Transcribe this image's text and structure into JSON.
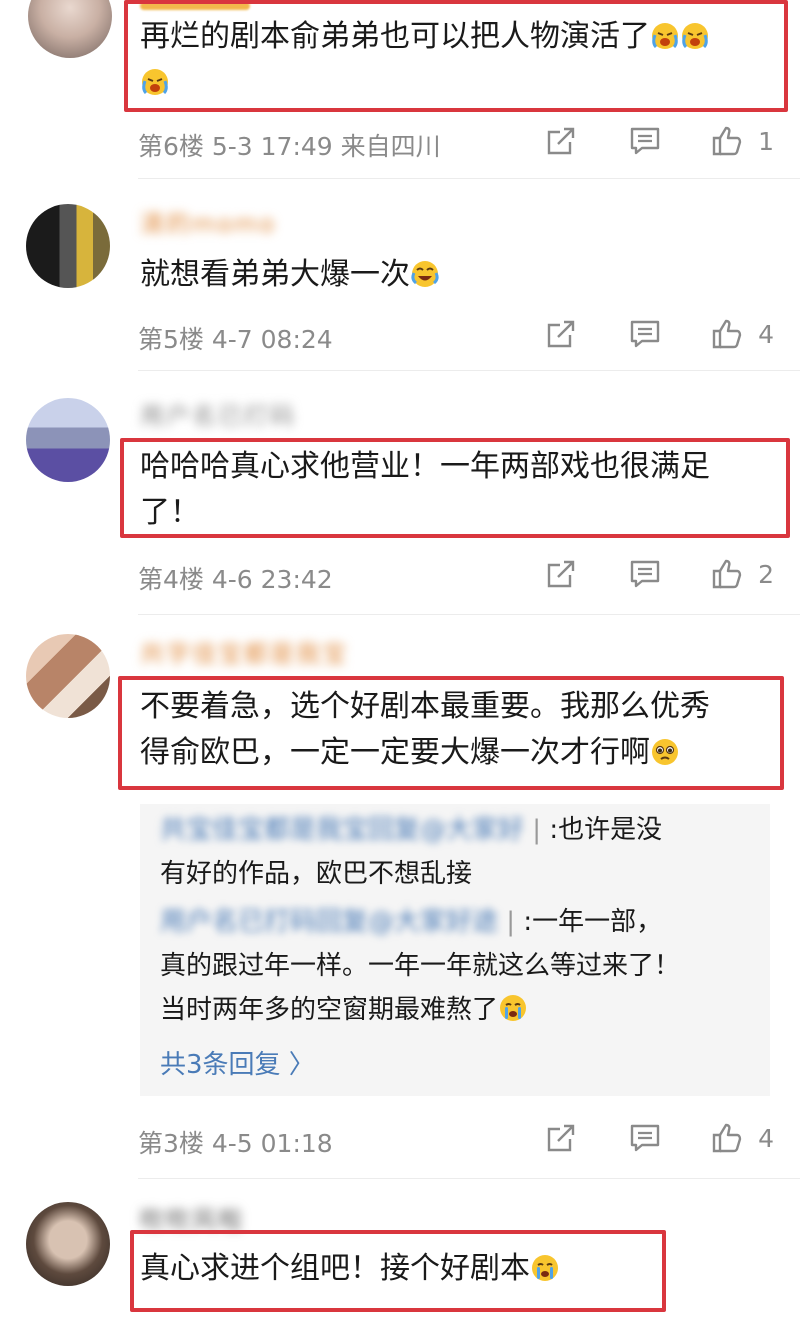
{
  "comments": [
    {
      "text_line1": "再烂的剧本俞弟弟也可以把人物演活了",
      "floor": "第6楼",
      "date": "5-3 17:49",
      "location": "来自四川",
      "likes": "1"
    },
    {
      "username": "清的momo",
      "text_line1": "就想看弟弟大爆一次",
      "floor": "第5楼",
      "date": "4-7 08:24",
      "likes": "4"
    },
    {
      "username": "用户名已打码",
      "text_line1": "哈哈哈真心求他营业！一年两部戏也很满足",
      "text_line2": "了！",
      "floor": "第4楼",
      "date": "4-6 23:42",
      "likes": "2"
    },
    {
      "username": "共字佳宝都是我宝",
      "text_line1": "不要着急，选个好剧本最重要。我那么优秀",
      "text_line2": "得俞欧巴，一定一定要大爆一次才行啊",
      "replies": [
        {
          "name": "共宝佳宝都是我宝回复@大家好",
          "line1": ":也许是没",
          "line2": "有好的作品，欧巴不想乱接"
        },
        {
          "name": "用户名已打码回复@大家好途",
          "line1": ":一年一部，",
          "line2": "真的跟过年一样。一年一年就这么等过来了！",
          "line3": "当时两年多的空窗期最难熬了"
        }
      ],
      "more_replies": "共3条回复 〉",
      "floor": "第3楼",
      "date": "4-5 01:18",
      "likes": "4"
    },
    {
      "username": "吹吹风啦",
      "text_line1": "真心求进个组吧！接个好剧本"
    }
  ],
  "icons": {
    "share": "share-icon",
    "comment": "comment-icon",
    "like": "thumbs-up-icon"
  },
  "colors": {
    "highlight_box": "#d9363e",
    "link": "#4a7bb7",
    "meta": "#8a8a8a"
  }
}
